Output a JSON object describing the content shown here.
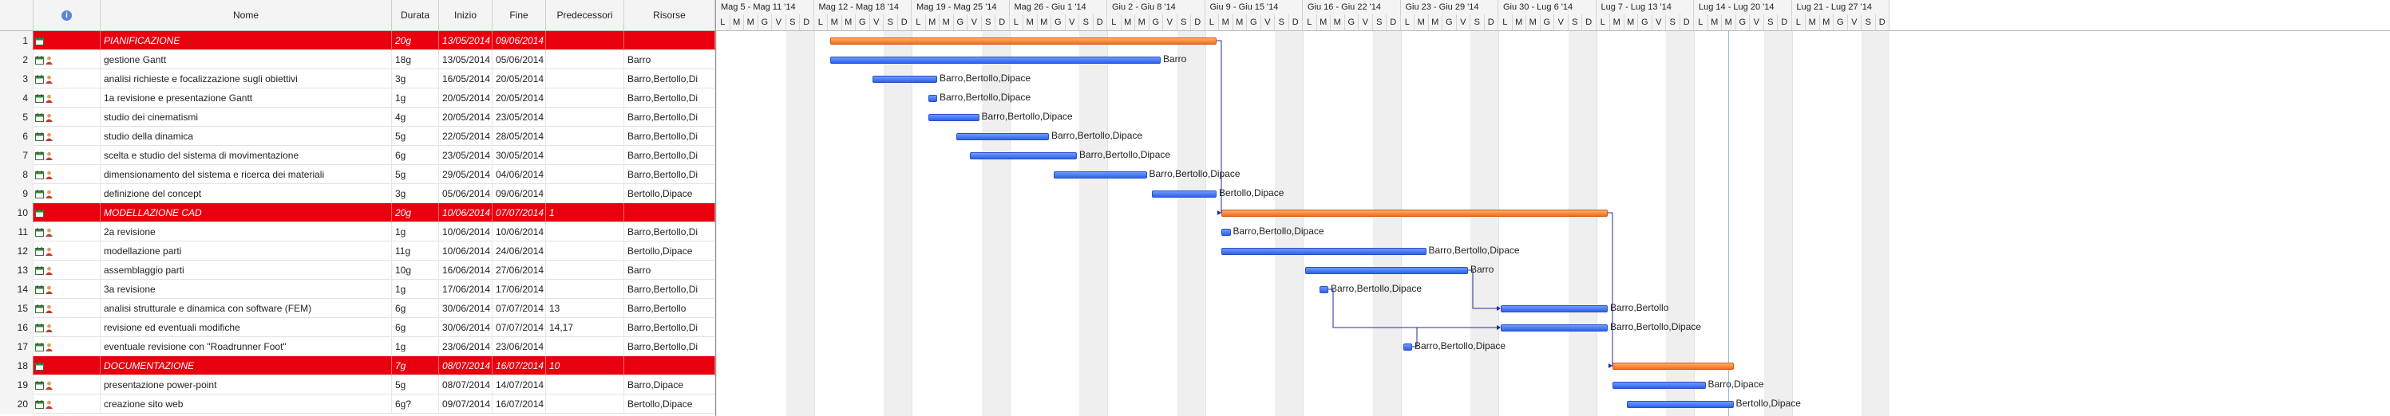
{
  "columns": {
    "num": "",
    "ind": "i",
    "name": "Nome",
    "duration": "Durata",
    "start": "Inizio",
    "finish": "Fine",
    "pred": "Predecessori",
    "res": "Risorse"
  },
  "rows": [
    {
      "num": "1",
      "name": "PIANIFICAZIONE",
      "duration": "20g",
      "start": "13/05/2014",
      "finish": "09/06/2014",
      "pred": "",
      "res": "",
      "summary": true
    },
    {
      "num": "2",
      "name": "gestione Gantt",
      "duration": "18g",
      "start": "13/05/2014",
      "finish": "05/06/2014",
      "pred": "",
      "res": "Barro",
      "summary": false
    },
    {
      "num": "3",
      "name": "analisi richieste e focalizzazione sugli obiettivi",
      "duration": "3g",
      "start": "16/05/2014",
      "finish": "20/05/2014",
      "pred": "",
      "res": "Barro,Bertollo,Di",
      "summary": false
    },
    {
      "num": "4",
      "name": "1a revisione e presentazione Gantt",
      "duration": "1g",
      "start": "20/05/2014",
      "finish": "20/05/2014",
      "pred": "",
      "res": "Barro,Bertollo,Di",
      "summary": false
    },
    {
      "num": "5",
      "name": "studio dei cinematismi",
      "duration": "4g",
      "start": "20/05/2014",
      "finish": "23/05/2014",
      "pred": "",
      "res": "Barro,Bertollo,Di",
      "summary": false
    },
    {
      "num": "6",
      "name": "studio della dinamica",
      "duration": "5g",
      "start": "22/05/2014",
      "finish": "28/05/2014",
      "pred": "",
      "res": "Barro,Bertollo,Di",
      "summary": false
    },
    {
      "num": "7",
      "name": "scelta e studio del sistema di movimentazione",
      "duration": "6g",
      "start": "23/05/2014",
      "finish": "30/05/2014",
      "pred": "",
      "res": "Barro,Bertollo,Di",
      "summary": false
    },
    {
      "num": "8",
      "name": "dimensionamento del sistema e ricerca dei materiali",
      "duration": "5g",
      "start": "29/05/2014",
      "finish": "04/06/2014",
      "pred": "",
      "res": "Barro,Bertollo,Di",
      "summary": false
    },
    {
      "num": "9",
      "name": "definizione del concept",
      "duration": "3g",
      "start": "05/06/2014",
      "finish": "09/06/2014",
      "pred": "",
      "res": "Bertollo,Dipace",
      "summary": false
    },
    {
      "num": "10",
      "name": "MODELLAZIONE CAD",
      "duration": "20g",
      "start": "10/06/2014",
      "finish": "07/07/2014",
      "pred": "1",
      "res": "",
      "summary": true
    },
    {
      "num": "11",
      "name": "2a revisione",
      "duration": "1g",
      "start": "10/06/2014",
      "finish": "10/06/2014",
      "pred": "",
      "res": "Barro,Bertollo,Di",
      "summary": false
    },
    {
      "num": "12",
      "name": "modellazione parti",
      "duration": "11g",
      "start": "10/06/2014",
      "finish": "24/06/2014",
      "pred": "",
      "res": "Bertollo,Dipace",
      "summary": false
    },
    {
      "num": "13",
      "name": "assemblaggio parti",
      "duration": "10g",
      "start": "16/06/2014",
      "finish": "27/06/2014",
      "pred": "",
      "res": "Barro",
      "summary": false
    },
    {
      "num": "14",
      "name": "3a revisione",
      "duration": "1g",
      "start": "17/06/2014",
      "finish": "17/06/2014",
      "pred": "",
      "res": "Barro,Bertollo,Di",
      "summary": false
    },
    {
      "num": "15",
      "name": "analisi strutturale e dinamica con software (FEM)",
      "duration": "6g",
      "start": "30/06/2014",
      "finish": "07/07/2014",
      "pred": "13",
      "res": "Barro,Bertollo",
      "summary": false
    },
    {
      "num": "16",
      "name": "revisione ed eventuali modifiche",
      "duration": "6g",
      "start": "30/06/2014",
      "finish": "07/07/2014",
      "pred": "14,17",
      "res": "Barro,Bertollo,Di",
      "summary": false
    },
    {
      "num": "17",
      "name": "eventuale revisione con \"Roadrunner Foot\"",
      "duration": "1g",
      "start": "23/06/2014",
      "finish": "23/06/2014",
      "pred": "",
      "res": "Barro,Bertollo,Di",
      "summary": false
    },
    {
      "num": "18",
      "name": "DOCUMENTAZIONE",
      "duration": "7g",
      "start": "08/07/2014",
      "finish": "16/07/2014",
      "pred": "10",
      "res": "",
      "summary": true
    },
    {
      "num": "19",
      "name": "presentazione power-point",
      "duration": "5g",
      "start": "08/07/2014",
      "finish": "14/07/2014",
      "pred": "",
      "res": "Barro,Dipace",
      "summary": false
    },
    {
      "num": "20",
      "name": "creazione sito web",
      "duration": "6g?",
      "start": "09/07/2014",
      "finish": "16/07/2014",
      "pred": "",
      "res": "Bertollo,Dipace",
      "summary": false
    }
  ],
  "timeline": {
    "weeks": [
      "Mag 5 - Mag 11 '14",
      "Mag 12 - Mag 18 '14",
      "Mag 19 - Mag 25 '14",
      "Mag 26 - Giu 1 '14",
      "Giu 2 - Giu 8 '14",
      "Giu 9 - Giu 15 '14",
      "Giu 16 - Giu 22 '14",
      "Giu 23 - Giu 29 '14",
      "Giu 30 - Lug 6 '14",
      "Lug 7 - Lug 13 '14",
      "Lug 14 - Lug 20 '14",
      "Lug 21 - Lug 27 '14"
    ],
    "day_letters": [
      "L",
      "M",
      "M",
      "G",
      "V",
      "S",
      "D"
    ]
  },
  "bars": [
    {
      "row": 1,
      "start": 8,
      "end": 35,
      "type": "sum",
      "label": ""
    },
    {
      "row": 2,
      "start": 8,
      "end": 31,
      "type": "task",
      "label": "Barro"
    },
    {
      "row": 3,
      "start": 11,
      "end": 15,
      "type": "task",
      "label": "Barro,Bertollo,Dipace"
    },
    {
      "row": 4,
      "start": 15,
      "end": 15,
      "type": "task",
      "label": "Barro,Bertollo,Dipace"
    },
    {
      "row": 5,
      "start": 15,
      "end": 18,
      "type": "task",
      "label": "Barro,Bertollo,Dipace"
    },
    {
      "row": 6,
      "start": 17,
      "end": 23,
      "type": "task",
      "label": "Barro,Bertollo,Dipace"
    },
    {
      "row": 7,
      "start": 18,
      "end": 25,
      "type": "task",
      "label": "Barro,Bertollo,Dipace"
    },
    {
      "row": 8,
      "start": 24,
      "end": 30,
      "type": "task",
      "label": "Barro,Bertollo,Dipace"
    },
    {
      "row": 9,
      "start": 31,
      "end": 35,
      "type": "task",
      "label": "Bertollo,Dipace"
    },
    {
      "row": 10,
      "start": 36,
      "end": 63,
      "type": "sum",
      "label": ""
    },
    {
      "row": 11,
      "start": 36,
      "end": 36,
      "type": "task",
      "label": "Barro,Bertollo,Dipace"
    },
    {
      "row": 12,
      "start": 36,
      "end": 50,
      "type": "task",
      "label": "Barro,Bertollo,Dipace"
    },
    {
      "row": 13,
      "start": 42,
      "end": 53,
      "type": "task",
      "label": "Barro"
    },
    {
      "row": 14,
      "start": 43,
      "end": 43,
      "type": "task",
      "label": "Barro,Bertollo,Dipace"
    },
    {
      "row": 15,
      "start": 56,
      "end": 63,
      "type": "task",
      "label": "Barro,Bertollo"
    },
    {
      "row": 16,
      "start": 56,
      "end": 63,
      "type": "task",
      "label": "Barro,Bertollo,Dipace"
    },
    {
      "row": 17,
      "start": 49,
      "end": 49,
      "type": "task",
      "label": "Barro,Bertollo,Dipace"
    },
    {
      "row": 18,
      "start": 64,
      "end": 72,
      "type": "sum",
      "label": ""
    },
    {
      "row": 19,
      "start": 64,
      "end": 70,
      "type": "task",
      "label": "Barro,Dipace"
    },
    {
      "row": 20,
      "start": 65,
      "end": 72,
      "type": "task",
      "label": "Bertollo,Dipace"
    }
  ]
}
